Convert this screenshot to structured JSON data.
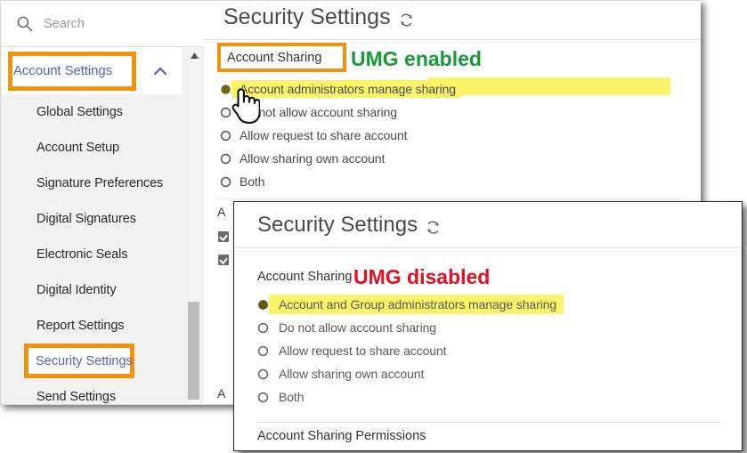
{
  "colors": {
    "accent_orange": "#f2910d",
    "link_purple": "#5a5fbe",
    "highlight_yellow": "#fbf46a",
    "umg_enabled_green": "#169b38",
    "umg_disabled_red": "#e01122",
    "panel_bg": "#ffffff",
    "sidebar_bg": "#f2f2f2"
  },
  "sidebar": {
    "search": {
      "icon": "search-icon",
      "placeholder": "Search",
      "value": ""
    },
    "group": {
      "label": "Account Settings",
      "expand_icon": "chevron-up-icon",
      "expanded": true
    },
    "items": [
      {
        "label": "Global Settings",
        "selected": false
      },
      {
        "label": "Account Setup",
        "selected": false
      },
      {
        "label": "Signature Preferences",
        "selected": false
      },
      {
        "label": "Digital Signatures",
        "selected": false
      },
      {
        "label": "Electronic Seals",
        "selected": false
      },
      {
        "label": "Digital Identity",
        "selected": false
      },
      {
        "label": "Report Settings",
        "selected": false
      },
      {
        "label": "Security Settings",
        "selected": true
      },
      {
        "label": "Send Settings",
        "selected": false
      }
    ],
    "scrollbar": {
      "up_arrow_icon": "triangle-up-icon",
      "thumb_visible": true
    }
  },
  "main_panel": {
    "title": "Security Settings",
    "refresh_icon": "refresh-icon",
    "section_label": "Account Sharing",
    "annotation": "UMG enabled",
    "radio_options": [
      {
        "label": "Account administrators manage sharing",
        "selected": true,
        "highlighted": true
      },
      {
        "label": "Do not allow account sharing",
        "selected": false,
        "highlighted": false
      },
      {
        "label": "Allow request to share account",
        "selected": false,
        "highlighted": false
      },
      {
        "label": "Allow sharing own account",
        "selected": false,
        "highlighted": false
      },
      {
        "label": "Both",
        "selected": false,
        "highlighted": false
      }
    ],
    "background_occluded": {
      "label_1": "A",
      "label_2": "A"
    },
    "cursor": "hand-pointer-cursor"
  },
  "popup": {
    "title": "Security Settings",
    "refresh_icon": "refresh-icon",
    "section_label": "Account Sharing",
    "annotation": "UMG disabled",
    "radio_options": [
      {
        "label": "Account and Group administrators manage sharing",
        "selected": true,
        "highlighted": true
      },
      {
        "label": "Do not allow account sharing",
        "selected": false,
        "highlighted": false
      },
      {
        "label": "Allow request to share account",
        "selected": false,
        "highlighted": false
      },
      {
        "label": "Allow sharing own account",
        "selected": false,
        "highlighted": false
      },
      {
        "label": "Both",
        "selected": false,
        "highlighted": false
      }
    ],
    "footer_section_label": "Account Sharing Permissions"
  }
}
